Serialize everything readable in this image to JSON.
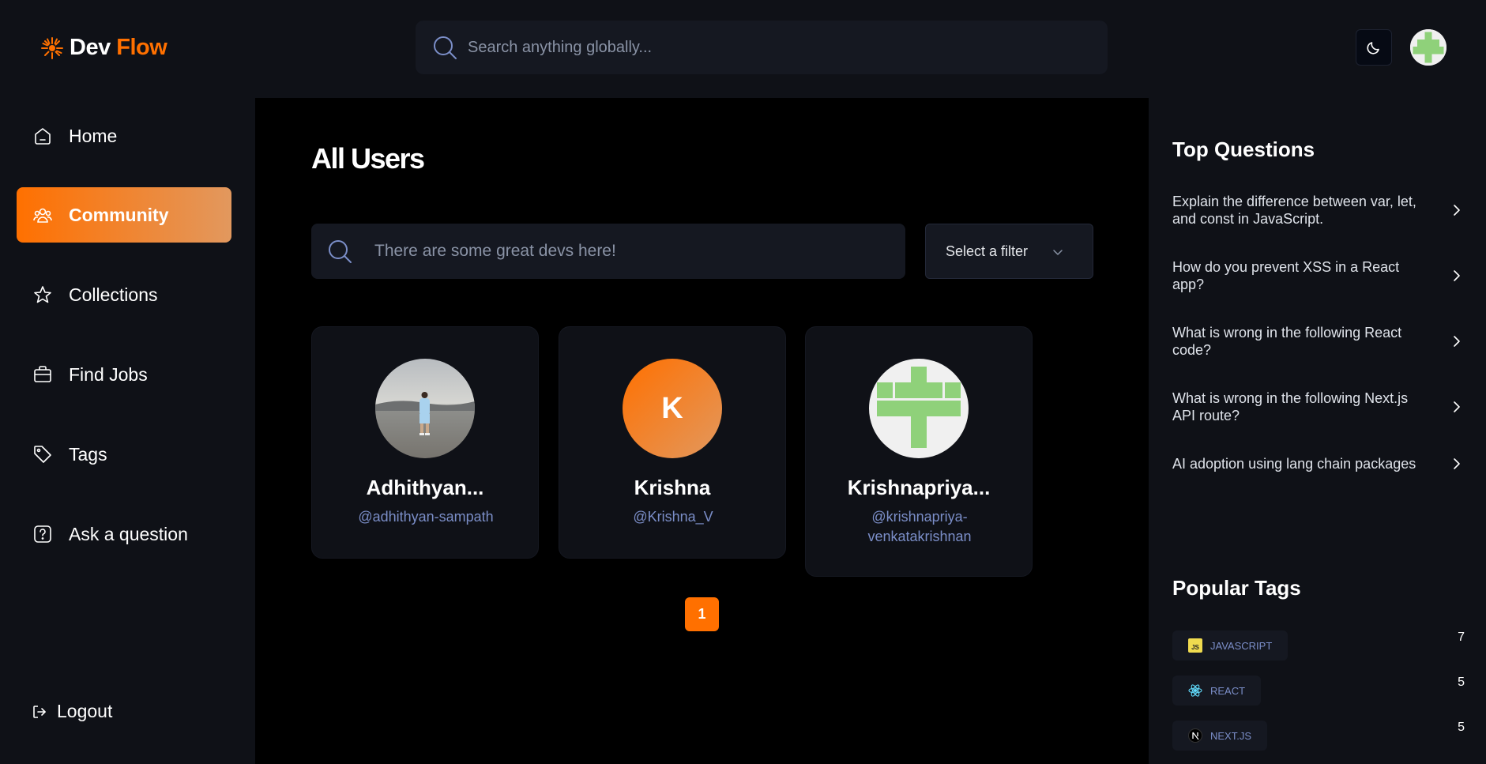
{
  "brand": {
    "part1": "Dev",
    "part2": "Flow"
  },
  "header": {
    "search_placeholder": "Search anything globally..."
  },
  "sidebar": {
    "items": [
      {
        "label": "Home",
        "icon": "home-icon",
        "active": false
      },
      {
        "label": "Community",
        "icon": "users-icon",
        "active": true
      },
      {
        "label": "Collections",
        "icon": "star-icon",
        "active": false
      },
      {
        "label": "Find Jobs",
        "icon": "briefcase-icon",
        "active": false
      },
      {
        "label": "Tags",
        "icon": "tag-icon",
        "active": false
      },
      {
        "label": "Ask a question",
        "icon": "question-icon",
        "active": false
      }
    ],
    "logout": "Logout"
  },
  "main": {
    "title": "All Users",
    "search_placeholder": "There are some great devs here!",
    "filter_label": "Select a filter",
    "users": [
      {
        "name": "Adhithyan...",
        "handle": "@adhithyan-sampath",
        "avatar": "photo"
      },
      {
        "name": "Krishna",
        "handle": "@Krishna_V",
        "avatar": "K"
      },
      {
        "name": "Krishnapriya...",
        "handle": "@krishnapriya-venkatakrishnan",
        "avatar": "identicon"
      }
    ],
    "page": "1"
  },
  "right_sidebar": {
    "top_questions_title": "Top Questions",
    "questions": [
      "Explain the difference between var, let, and const in JavaScript.",
      "How do you prevent XSS in a React app?",
      "What is wrong in the following React code?",
      "What is wrong in the following Next.js API route?",
      "AI adoption using lang chain packages"
    ],
    "popular_tags_title": "Popular Tags",
    "tags": [
      {
        "name": "javascript",
        "count": "7",
        "icon": "javascript-icon"
      },
      {
        "name": "react",
        "count": "5",
        "icon": "react-icon"
      },
      {
        "name": "next.js",
        "count": "5",
        "icon": "nextjs-icon"
      }
    ]
  },
  "colors": {
    "accent": "#ff7000",
    "accent_light": "#e2985e",
    "bg": "#000000",
    "panel": "#0f1117",
    "input": "#151821",
    "handle": "#7b8ec8"
  }
}
